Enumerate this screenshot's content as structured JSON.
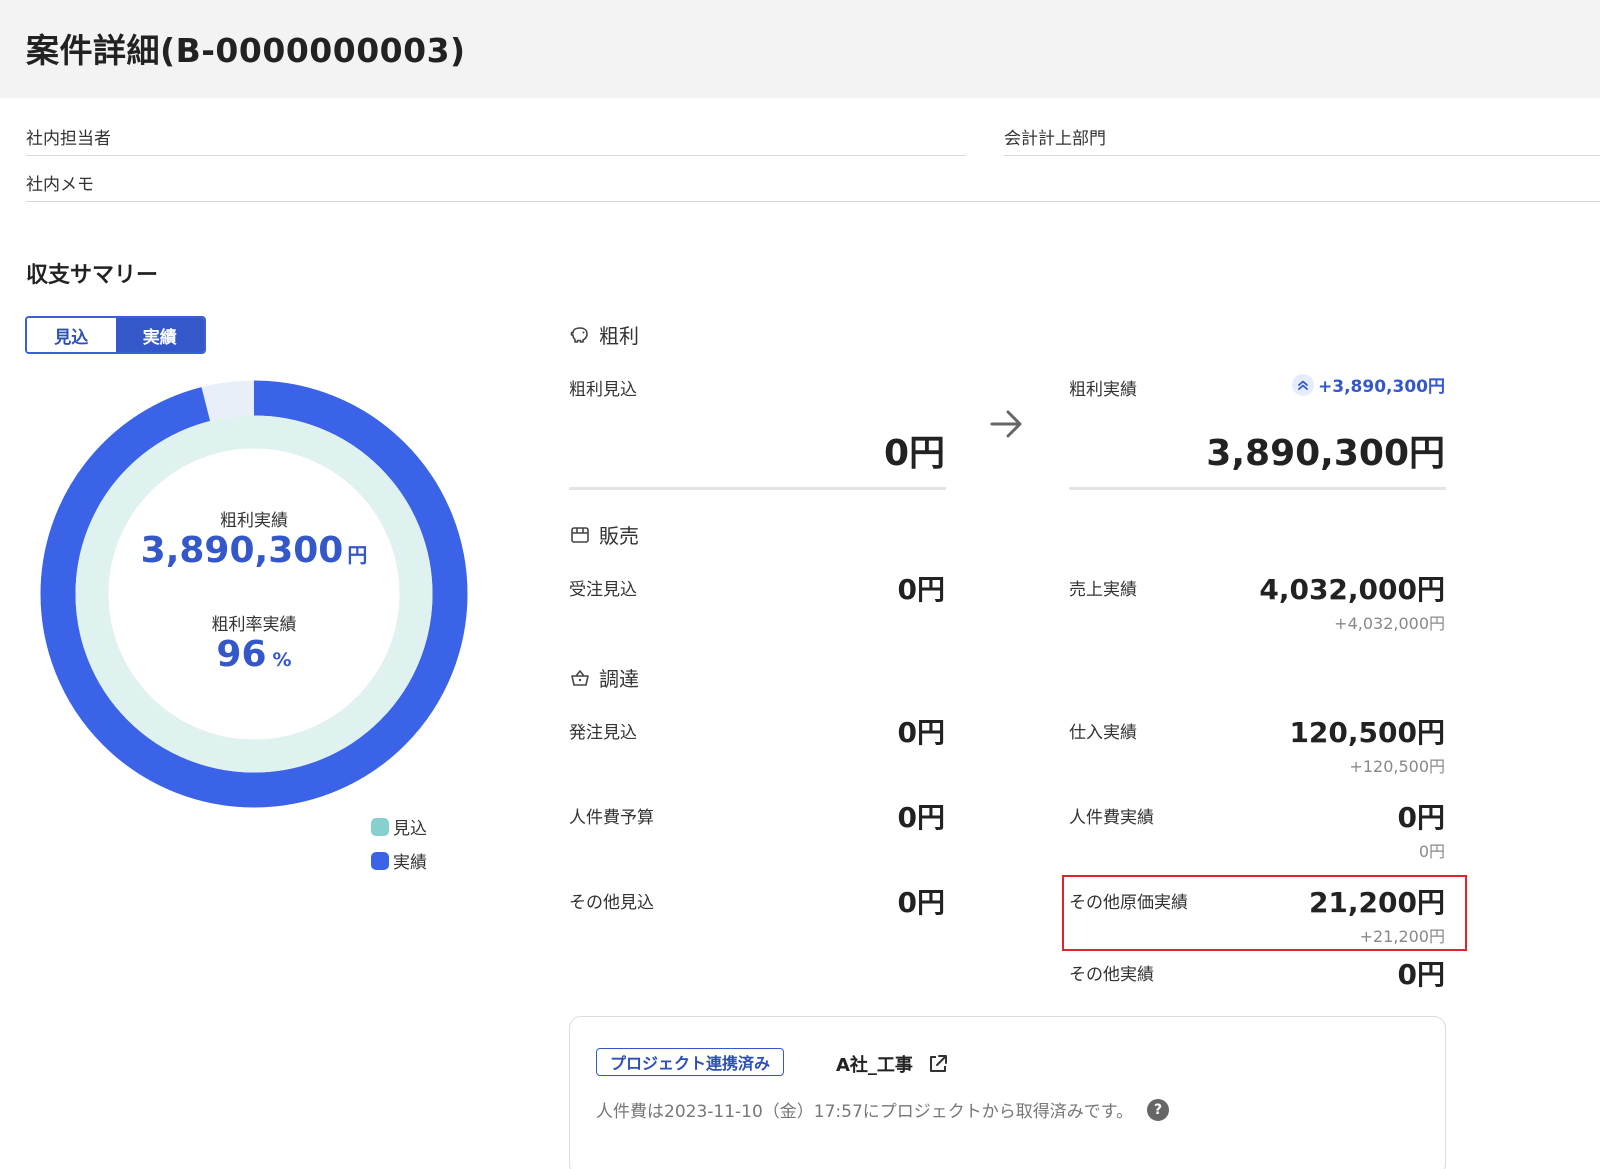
{
  "page": {
    "title": "案件詳細(B-0000000003)"
  },
  "fields": {
    "staff_label": "社内担当者",
    "dept_label": "会計計上部門",
    "memo_label": "社内メモ"
  },
  "summary": {
    "title": "収支サマリー",
    "toggle": {
      "forecast": "見込",
      "actual": "実績",
      "selected": "実績"
    },
    "donut": {
      "gross_profit_label": "粗利実績",
      "gross_profit_value": "3,890,300",
      "gross_profit_unit": "円",
      "rate_label": "粗利率実績",
      "rate_value": "96",
      "rate_unit": "%",
      "actual_fraction": 0.96,
      "colors": {
        "actual": "#3a63e8",
        "forecast": "#dff2ef",
        "remainder": "#e9eff9"
      }
    },
    "legend": [
      {
        "label": "見込",
        "color": "#86d0ce"
      },
      {
        "label": "実績",
        "color": "#3a63e8"
      }
    ]
  },
  "gross": {
    "category": "粗利",
    "forecast_label": "粗利見込",
    "forecast_value": "0円",
    "actual_label": "粗利実績",
    "actual_value": "3,890,300円",
    "diff": "+3,890,300円"
  },
  "sales": {
    "category": "販売",
    "forecast_label": "受注見込",
    "forecast_value": "0円",
    "actual_label": "売上実績",
    "actual_value": "4,032,000円",
    "actual_diff": "+4,032,000円"
  },
  "procurement": {
    "category": "調達",
    "order_label": "発注見込",
    "order_value": "0円",
    "purchase_label": "仕入実績",
    "purchase_value": "120,500円",
    "purchase_diff": "+120,500円",
    "labor_budget_label": "人件費予算",
    "labor_budget_value": "0円",
    "labor_actual_label": "人件費実績",
    "labor_actual_value": "0円",
    "labor_actual_diff": "0円",
    "other_forecast_label": "その他見込",
    "other_forecast_value": "0円",
    "other_cost_label": "その他原価実績",
    "other_cost_value": "21,200円",
    "other_cost_diff": "+21,200円",
    "other_actual_label": "その他実績",
    "other_actual_value": "0円"
  },
  "project": {
    "badge": "プロジェクト連携済み",
    "name": "A社_工事",
    "note": "人件費は2023-11-10（金）17:57にプロジェクトから取得済みです。",
    "help": "?"
  }
}
